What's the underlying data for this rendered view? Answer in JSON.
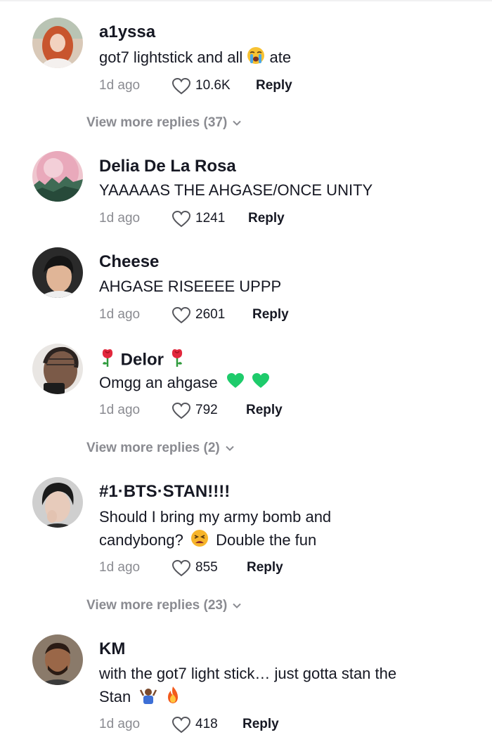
{
  "comments": [
    {
      "username": "a1yssa",
      "text_before": "got7 lightstick and all",
      "text_after": "ate",
      "time": "1d ago",
      "likes": "10.6K",
      "reply_label": "Reply",
      "more_replies": "View more replies (37)"
    },
    {
      "username": "Delia De La Rosa",
      "text": "YAAAAAS THE AHGASE/ONCE UNITY",
      "time": "1d ago",
      "likes": "1241",
      "reply_label": "Reply"
    },
    {
      "username": "Cheese",
      "text": "AHGASE RISEEEE UPPP",
      "time": "1d ago",
      "likes": "2601",
      "reply_label": "Reply"
    },
    {
      "username": "Delor",
      "text": "Omgg an ahgase",
      "time": "1d ago",
      "likes": "792",
      "reply_label": "Reply",
      "more_replies": "View more replies (2)"
    },
    {
      "username": "#1·BTS·STAN!!!!",
      "text_line1": "Should I bring my army bomb and",
      "text_line2_before": "candybong?",
      "text_line2_after": "Double the fun",
      "time": "1d ago",
      "likes": "855",
      "reply_label": "Reply",
      "more_replies": "View more replies (23)"
    },
    {
      "username": "KM",
      "text_line1": "with the got7 light stick… just gotta stan the",
      "text_line2": "Stan",
      "time": "1d ago",
      "likes": "418",
      "reply_label": "Reply"
    }
  ],
  "colors": {
    "text": "#161823",
    "muted": "#8a8b91",
    "green_heart": "#1ecb6b"
  },
  "icons": {
    "like": "heart-outline-icon",
    "expand": "chevron-down-icon",
    "emoji_crying": "loudly-crying-face-emoji",
    "emoji_rose": "wilted-rose-emoji",
    "emoji_green_heart": "green-heart-emoji",
    "emoji_tired": "tired-face-emoji",
    "emoji_shrug": "person-shrugging-emoji",
    "emoji_fire": "fire-emoji"
  }
}
